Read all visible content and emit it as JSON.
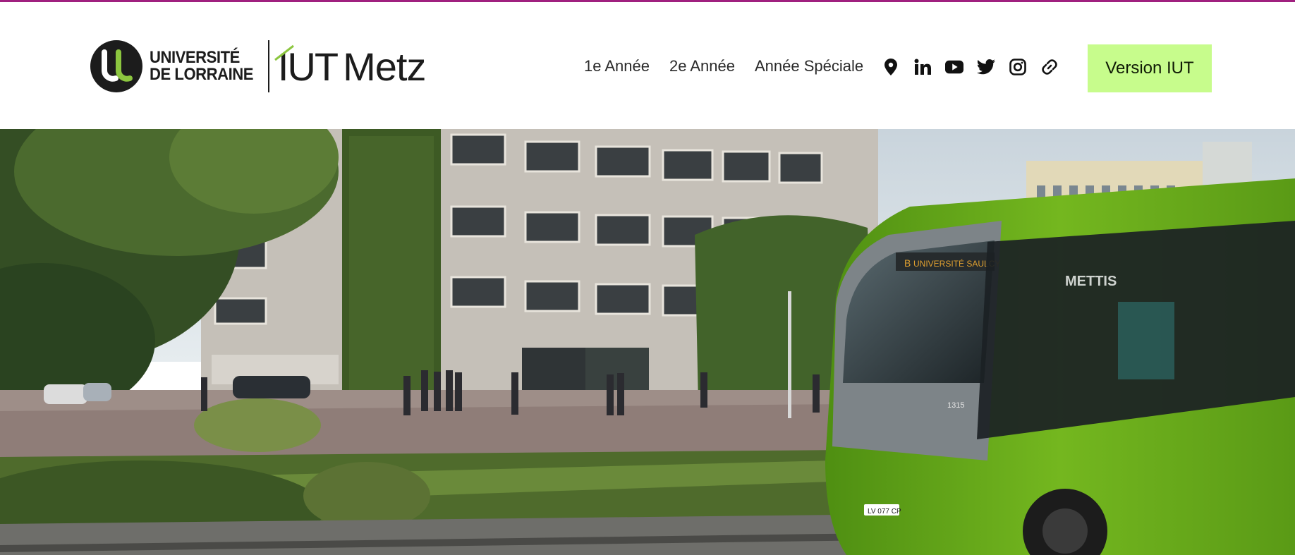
{
  "header": {
    "logo": {
      "university_line1": "UNIVERSITÉ",
      "university_line2": "DE LORRAINE",
      "iut_label": "IUT",
      "city_label": "Metz"
    },
    "nav": [
      {
        "label": "1e Année"
      },
      {
        "label": "2e Année"
      },
      {
        "label": "Année Spéciale"
      }
    ],
    "social_icons": [
      "location-pin-icon",
      "linkedin-icon",
      "youtube-icon",
      "twitter-icon",
      "instagram-icon",
      "link-icon"
    ],
    "version_button": "Version IUT"
  },
  "hero": {
    "bus_sign": "UNIVERSITÉ SAULCY",
    "bus_route": "B",
    "bus_brand": "METTIS",
    "bus_number": "1315",
    "bus_plate": "LV 077 CP"
  },
  "colors": {
    "accent_top": "#a0207f",
    "button_bg": "#c7fc8c",
    "bus_green": "#6fb51e",
    "logo_green": "#8cc63f"
  }
}
